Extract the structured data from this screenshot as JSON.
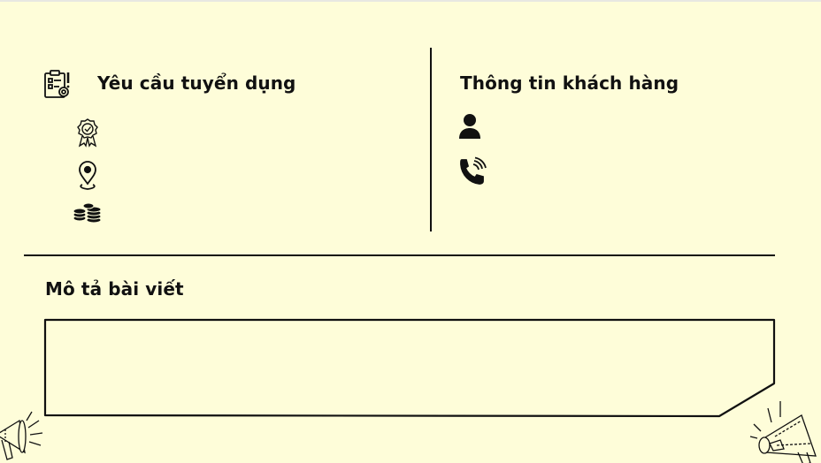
{
  "requirements": {
    "title": "Yêu cầu tuyển dụng",
    "items": [
      {
        "icon": "award-badge-icon"
      },
      {
        "icon": "location-pin-icon"
      },
      {
        "icon": "coins-icon"
      }
    ]
  },
  "customer": {
    "title": "Thông tin khách hàng",
    "items": [
      {
        "icon": "person-icon"
      },
      {
        "icon": "phone-icon"
      }
    ]
  },
  "description": {
    "title": "Mô tả bài viết"
  },
  "colors": {
    "background": "#fefdd9",
    "ink": "#111111"
  }
}
